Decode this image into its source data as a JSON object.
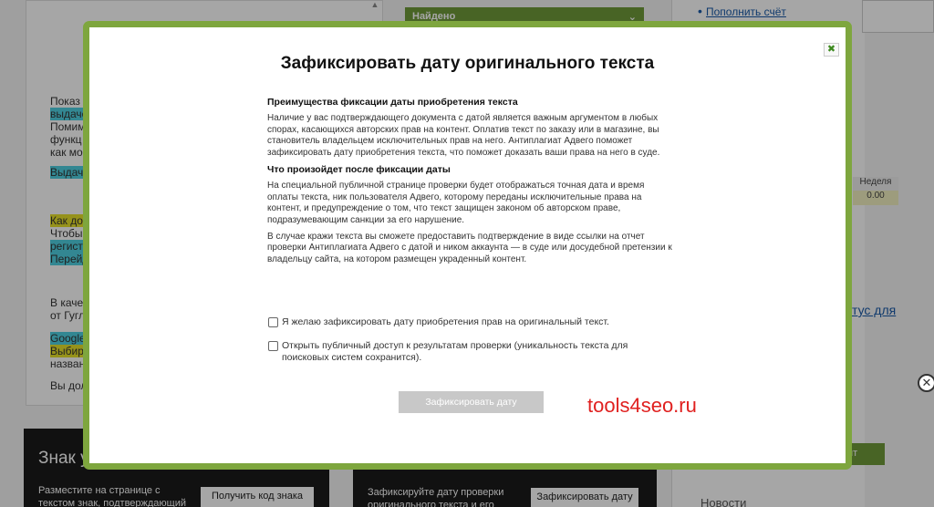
{
  "background": {
    "left_lines": [
      {
        "text": "Показ к",
        "hl": ""
      },
      {
        "text": "выдаче",
        "hl": "cyan"
      },
      {
        "text": "Помим",
        "hl": ""
      },
      {
        "text": "функц",
        "hl": ""
      },
      {
        "text": "как мо",
        "hl": ""
      },
      {
        "text": "Выдача",
        "hl": "cyan"
      },
      {
        "text": "Как до",
        "hl": "yellow"
      },
      {
        "text": "Чтобы",
        "hl": ""
      },
      {
        "text": "регист",
        "hl": "cyan"
      },
      {
        "text": "Перейд",
        "hl": "cyan"
      },
      {
        "text": "В качес",
        "hl": ""
      },
      {
        "text": "от Гугл",
        "hl": ""
      },
      {
        "text": "Google",
        "hl": "cyan"
      },
      {
        "text": "Выбира",
        "hl": "yellow"
      },
      {
        "text": "назван",
        "hl": ""
      },
      {
        "text": "Вы дол",
        "hl": ""
      }
    ],
    "found_label": "Найдено",
    "topup_link": "Пополнить счёт",
    "week_header": "Неделя",
    "week_value": "0.00",
    "status_link": "тус для",
    "green_button": "нт",
    "news_heading": "Новости",
    "promo_left": {
      "title": "Знак у",
      "text": "Разместите на странице с текстом знак, подтверждающий",
      "button": "Получить код знака"
    },
    "promo_right": {
      "text": "Зафиксируйте дату проверки оригинального текста и его",
      "button": "Зафиксировать дату"
    }
  },
  "modal": {
    "title": "Зафиксировать дату оригинального текста",
    "close_glyph": "✖",
    "section1_heading": "Преимущества фиксации даты приобретения текста",
    "section1_text": "Наличие у вас подтверждающего документа с датой является важным аргументом в любых спорах, касающихся авторских прав на контент. Оплатив текст по заказу или в магазине, вы становитель владельцем исключительных прав на него. Антиплагиат Адвего поможет зафиксировать дату приобретения текста, что поможет доказать ваши права на него в суде.",
    "section2_heading": "Что произойдет после фиксации даты",
    "section2_text1": "На специальной публичной странице проверки будет отображаться точная дата и время оплаты текста, ник пользователя Адвего, которому переданы исключительные права на контент, и предупреждение о том, что текст защищен законом об авторском праве, подразумевающим санкции за его нарушение.",
    "section2_text2": "В случае кражи текста вы сможете предоставить подтверждение в виде ссылки на отчет проверки Антиплагиата Адвего с датой и ником аккаунта — в суде или досудебной претензии к владельцу сайта, на котором размещен украденный контент.",
    "checkbox1_label": "Я желаю зафиксировать дату приобретения прав на оригинальный текст.",
    "checkbox2_label": "Открыть публичный доступ к результатам проверки (уникальность текста для поисковых систем сохранится).",
    "submit_label": "Зафиксировать дату"
  },
  "watermark": "tools4seo.ru",
  "outer_close_glyph": "✕",
  "colors": {
    "modal_border": "#7ea63e",
    "submit_disabled": "#c8c8c8",
    "watermark": "#e0201f",
    "link": "#1a5aa8"
  }
}
